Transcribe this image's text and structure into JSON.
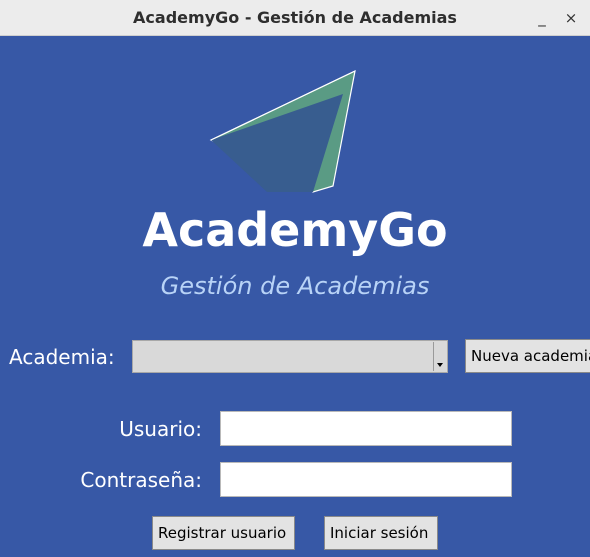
{
  "window": {
    "title": "AcademyGo - Gestión de Academias",
    "minimize_glyph": "_",
    "close_glyph": "×"
  },
  "brand": {
    "app_name": "AcademyGo",
    "subtitle": "Gestión de Academias",
    "logo_icon": "paper-plane-logo"
  },
  "form": {
    "academia_label": "Academia:",
    "academia_selected": "",
    "nueva_academia_button": "Nueva academia",
    "usuario_label": "Usuario:",
    "usuario_value": "",
    "password_label": "Contraseña:",
    "password_value": ""
  },
  "actions": {
    "register_button": "Registrar usuario",
    "login_button": "Iniciar sesión"
  },
  "colors": {
    "background": "#3758a6",
    "subtitle": "#b8d3f7",
    "logo_dark": "#385d8f",
    "logo_light": "#5a9b84"
  }
}
